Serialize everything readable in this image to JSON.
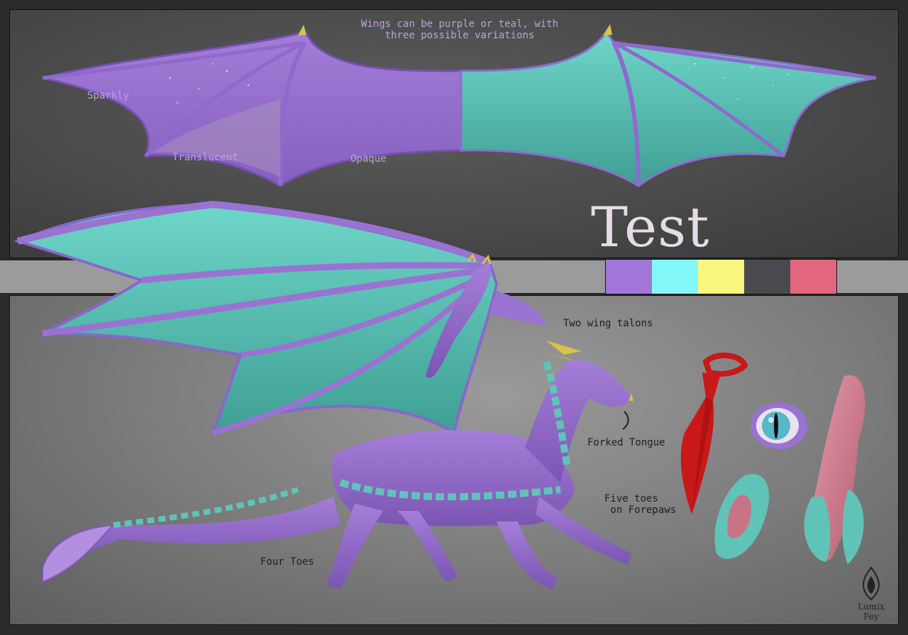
{
  "title": "Test",
  "wing_note": "Wings can be purple or teal, with\nthree possible variations",
  "wing_variants": [
    "Sparkly",
    "Translucent",
    "Opaque"
  ],
  "annotations": {
    "wing_talons": "Two wing talons",
    "tongue": "Forked Tongue",
    "forepaws": "Five toes\n on Forepaws",
    "hindpaws": "Four Toes"
  },
  "palette": [
    "#a077d8",
    "#84f7fa",
    "#f9f77d",
    "#4b4950",
    "#e2667e"
  ],
  "colors": {
    "purple": "#9a72d1",
    "teal": "#5fc4b7",
    "horn": "#d8c24a",
    "tie": "#c91818",
    "pink": "#c97387"
  },
  "signature": "Lumix Fey",
  "icons": [
    "dragon-illustration",
    "wing-spread-illustration",
    "eye-illustration",
    "necktie-illustration",
    "sheath-illustration",
    "artist-logo-icon"
  ]
}
